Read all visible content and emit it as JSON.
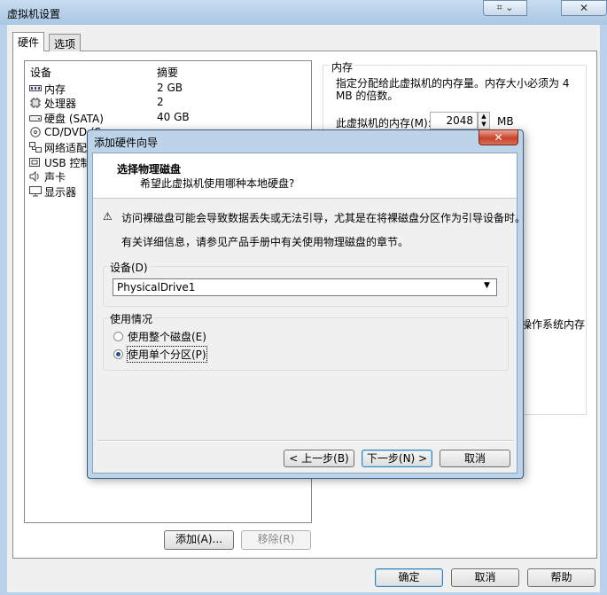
{
  "window": {
    "title": "虚拟机设置",
    "close_glyph": "✕",
    "help_glyph": "⌗ ⌄"
  },
  "tabs": [
    {
      "label": "硬件",
      "active": true
    },
    {
      "label": "选项",
      "active": false
    }
  ],
  "device_list": {
    "col_device": "设备",
    "col_summary": "摘要",
    "items": [
      {
        "icon": "memory-icon",
        "name": "内存",
        "summary": "2 GB"
      },
      {
        "icon": "processor-icon",
        "name": "处理器",
        "summary": "2"
      },
      {
        "icon": "hard-disk-icon",
        "name": "硬盘 (SATA)",
        "summary": "40 GB"
      },
      {
        "icon": "cd-dvd-icon",
        "name": "CD/DVD (S",
        "summary": ""
      },
      {
        "icon": "network-adapter-icon",
        "name": "网络适配器",
        "summary": ""
      },
      {
        "icon": "usb-controller-icon",
        "name": "USB 控制器",
        "summary": ""
      },
      {
        "icon": "sound-card-icon",
        "name": "声卡",
        "summary": ""
      },
      {
        "icon": "display-icon",
        "name": "显示器",
        "summary": ""
      }
    ],
    "add_label": "添加(A)...",
    "remove_label": "移除(R)"
  },
  "memory_panel": {
    "title": "内存",
    "description": "指定分配给此虚拟机的内存量。内存大小必须为 4 MB 的倍数。",
    "label": "此虚拟机的内存(M):",
    "value": "2048",
    "unit": "MB",
    "os_text": "操作系统内存"
  },
  "footer": {
    "ok_label": "确定",
    "cancel_label": "取消",
    "help_label": "帮助"
  },
  "dialog": {
    "title": "添加硬件向导",
    "close_glyph": "✕",
    "header_title": "选择物理磁盘",
    "header_subtitle": "希望此虚拟机使用哪种本地硬盘?",
    "warning_glyph": "⚠",
    "warning_text": "访问裸磁盘可能会导致数据丢失或无法引导，尤其是在将裸磁盘分区作为引导设备时。",
    "info_text": "有关详细信息，请参见产品手册中有关使用物理磁盘的章节。",
    "device_label": "设备(D)",
    "device_value": "PhysicalDrive1",
    "usage_label": "使用情况",
    "radio_entire": "使用整个磁盘(E)",
    "radio_partition": "使用单个分区(P)",
    "back_label": "< 上一步(B)",
    "next_label": "下一步(N) >",
    "cancel_label": "取消"
  }
}
